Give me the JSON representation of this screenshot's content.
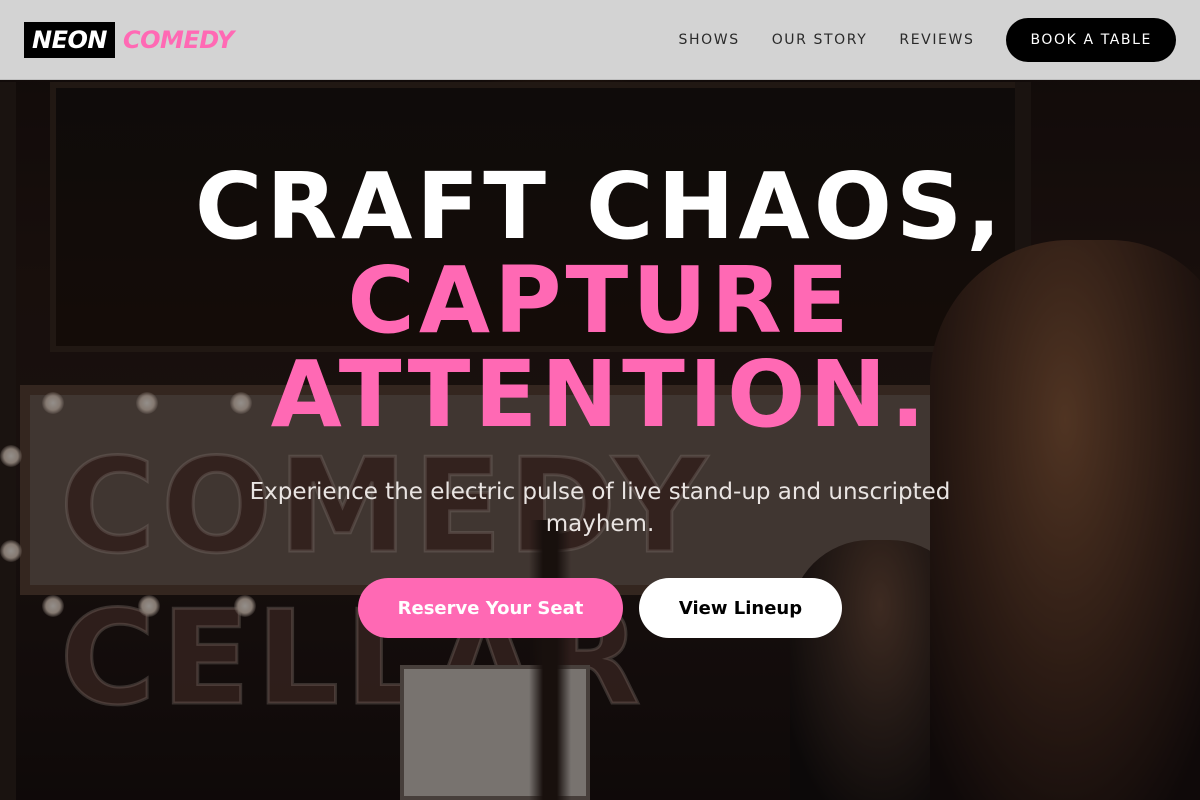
{
  "brand": {
    "logo_dark": "NEON",
    "logo_pink": "COMEDY",
    "accent_color": "#ff69b4"
  },
  "nav": {
    "links": [
      {
        "label": "SHOWS"
      },
      {
        "label": "OUR STORY"
      },
      {
        "label": "REVIEWS"
      }
    ],
    "cta_label": "BOOK A TABLE"
  },
  "hero": {
    "headline_line1": "CRAFT CHAOS,",
    "headline_line2": "CAPTURE",
    "headline_line3": "ATTENTION.",
    "subtitle": "Experience the electric pulse of live stand-up and unscripted mayhem.",
    "primary_button": "Reserve Your Seat",
    "secondary_button": "View Lineup",
    "background_sign_text": "COMEDY CELLAR"
  }
}
